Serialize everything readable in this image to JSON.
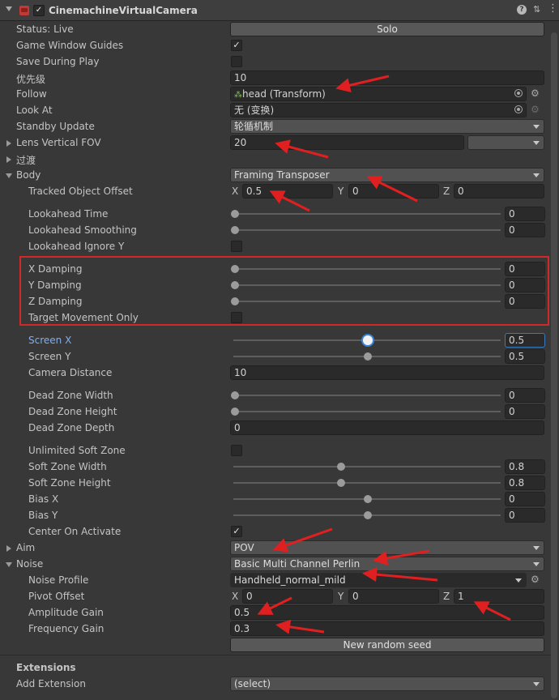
{
  "component": {
    "title": "CinemachineVirtualCamera",
    "enabled": true
  },
  "status": {
    "label": "Status: Live",
    "solo_label": "Solo"
  },
  "game_window_guides": {
    "label": "Game Window Guides",
    "checked": true
  },
  "save_during_play": {
    "label": "Save During Play",
    "checked": false
  },
  "priority": {
    "label": "优先级",
    "value": "10"
  },
  "follow": {
    "label": "Follow",
    "value": "head (Transform)"
  },
  "look_at": {
    "label": "Look At",
    "value": "无 (变换)"
  },
  "standby_update": {
    "label": "Standby Update",
    "value": "轮循机制"
  },
  "lens": {
    "label": "Lens Vertical FOV",
    "value": "20",
    "preset": ""
  },
  "transition": {
    "label": "过渡"
  },
  "body": {
    "label": "Body",
    "value": "Framing Transposer",
    "tracked_object_offset": {
      "label": "Tracked Object Offset",
      "x": "0.5",
      "y": "0",
      "z": "0"
    },
    "lookahead_time": {
      "label": "Lookahead Time",
      "value": "0"
    },
    "lookahead_smoothing": {
      "label": "Lookahead Smoothing",
      "value": "0"
    },
    "lookahead_ignore_y": {
      "label": "Lookahead Ignore Y",
      "checked": false
    },
    "x_damping": {
      "label": "X Damping",
      "value": "0"
    },
    "y_damping": {
      "label": "Y Damping",
      "value": "0"
    },
    "z_damping": {
      "label": "Z Damping",
      "value": "0"
    },
    "target_movement_only": {
      "label": "Target Movement Only",
      "checked": false
    },
    "screen_x": {
      "label": "Screen X",
      "value": "0.5"
    },
    "screen_y": {
      "label": "Screen Y",
      "value": "0.5"
    },
    "camera_distance": {
      "label": "Camera Distance",
      "value": "10"
    },
    "dead_zone_width": {
      "label": "Dead Zone Width",
      "value": "0"
    },
    "dead_zone_height": {
      "label": "Dead Zone Height",
      "value": "0"
    },
    "dead_zone_depth": {
      "label": "Dead Zone Depth",
      "value": "0"
    },
    "unlimited_soft_zone": {
      "label": "Unlimited Soft Zone",
      "checked": false
    },
    "soft_zone_width": {
      "label": "Soft Zone Width",
      "value": "0.8"
    },
    "soft_zone_height": {
      "label": "Soft Zone Height",
      "value": "0.8"
    },
    "bias_x": {
      "label": "Bias X",
      "value": "0"
    },
    "bias_y": {
      "label": "Bias Y",
      "value": "0"
    },
    "center_on_activate": {
      "label": "Center On Activate",
      "checked": true
    }
  },
  "aim": {
    "label": "Aim",
    "value": "POV"
  },
  "noise": {
    "label": "Noise",
    "value": "Basic Multi Channel Perlin",
    "noise_profile": {
      "label": "Noise Profile",
      "value": "Handheld_normal_mild"
    },
    "pivot_offset": {
      "label": "Pivot Offset",
      "x": "0",
      "y": "0",
      "z": "1"
    },
    "amplitude_gain": {
      "label": "Amplitude Gain",
      "value": "0.5"
    },
    "frequency_gain": {
      "label": "Frequency Gain",
      "value": "0.3"
    },
    "random_seed_label": "New random seed"
  },
  "extensions": {
    "heading": "Extensions",
    "add_label": "Add Extension",
    "add_value": "(select)"
  },
  "axis_labels": {
    "x": "X",
    "y": "Y",
    "z": "Z"
  },
  "annotation_color": "#e02020",
  "highlight_color": "#d12828"
}
